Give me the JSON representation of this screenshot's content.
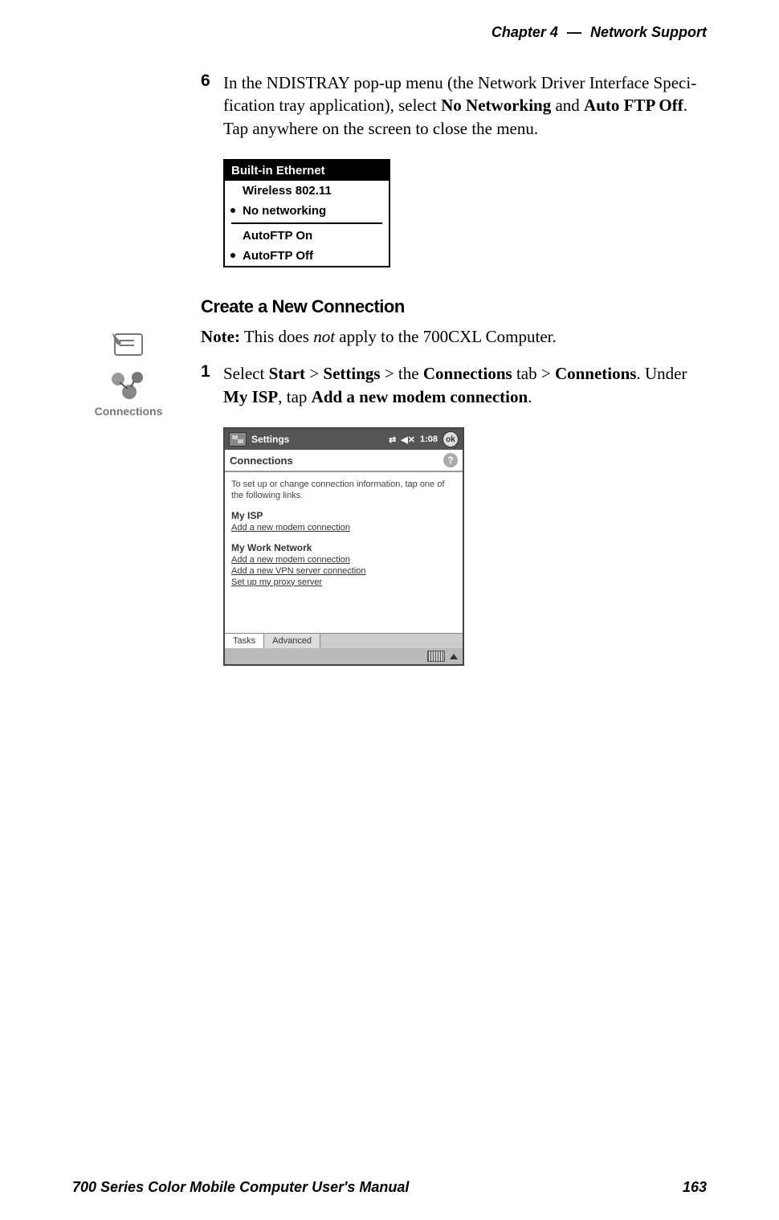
{
  "header": {
    "chapter_num": "Chapter  4",
    "sep": "—",
    "chapter_title": "Network Support"
  },
  "step6": {
    "num": "6",
    "t1": "In the NDISTRAY pop-up menu (the Network Driver Interface Speci-fication tray application), select ",
    "b1": "No Networking",
    "t2": " and ",
    "b2": "Auto FTP Off",
    "t3": ". Tap anywhere on the screen to close the menu."
  },
  "menu": {
    "title": "Built-in Ethernet",
    "item1": "Wireless 802.11",
    "item2": "No networking",
    "item3": "AutoFTP On",
    "item4": "AutoFTP Off"
  },
  "subhead": "Create a New Connection",
  "note": {
    "label": "Note:",
    "t1": " This does ",
    "i1": "not",
    "t2": " apply to the 700CXL Computer."
  },
  "side_icon_label": "Connections",
  "step1": {
    "num": "1",
    "t1": "Select ",
    "b1": "Start",
    "gt1": " > ",
    "b2": "Settings",
    "gt2": " > the ",
    "b3": "Connections",
    "t2": " tab > ",
    "b4": "Connetions",
    "t3": ". Under ",
    "b5": "My ISP",
    "t4": ", tap ",
    "b6": "Add a new modem connection",
    "t5": "."
  },
  "device": {
    "topbar_title": "Settings",
    "time": "1:08",
    "ok": "ok",
    "screen_title": "Connections",
    "help": "?",
    "hint": "To set up or change connection information, tap one of the following links.",
    "isp_label": "My ISP",
    "isp_link1": "Add a new modem connection",
    "work_label": "My Work Network",
    "work_link1": "Add a new modem connection",
    "work_link2": "Add a new VPN server connection",
    "work_link3": "Set up my proxy server",
    "tab1": "Tasks",
    "tab2": "Advanced"
  },
  "footer": {
    "left": "700 Series Color Mobile Computer User's Manual",
    "right": "163"
  }
}
